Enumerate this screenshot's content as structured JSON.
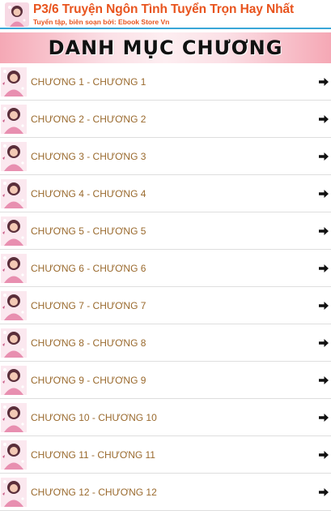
{
  "header": {
    "title": "P3/6 Truyện Ngôn Tình Tuyển Trọn Hay Nhất",
    "subtitle": "Tuyển tập, biên soạn bởi: Ebook Store Vn",
    "icon": "app-cover-icon"
  },
  "banner": {
    "title": "DANH MỤC CHƯƠNG"
  },
  "chapters": [
    {
      "label": "CHƯƠNG 1 - CHƯƠNG 1"
    },
    {
      "label": "CHƯƠNG 2 - CHƯƠNG 2"
    },
    {
      "label": "CHƯƠNG 3 - CHƯƠNG 3"
    },
    {
      "label": "CHƯƠNG 4 - CHƯƠNG 4"
    },
    {
      "label": "CHƯƠNG 5 - CHƯƠNG 5"
    },
    {
      "label": "CHƯƠNG 6 - CHƯƠNG 6"
    },
    {
      "label": "CHƯƠNG 7 - CHƯƠNG 7"
    },
    {
      "label": "CHƯƠNG 8 - CHƯƠNG 8"
    },
    {
      "label": "CHƯƠNG 9 - CHƯƠNG 9"
    },
    {
      "label": "CHƯƠNG 10 - CHƯƠNG 10"
    },
    {
      "label": "CHƯƠNG 11 - CHƯƠNG 11"
    },
    {
      "label": "CHƯƠNG 12 - CHƯƠNG 12"
    }
  ],
  "colors": {
    "accent_title": "#e8541e",
    "header_border": "#3aa7d8",
    "chapter_text": "#9a6a2e",
    "banner_pink": "#f5a8b5"
  }
}
